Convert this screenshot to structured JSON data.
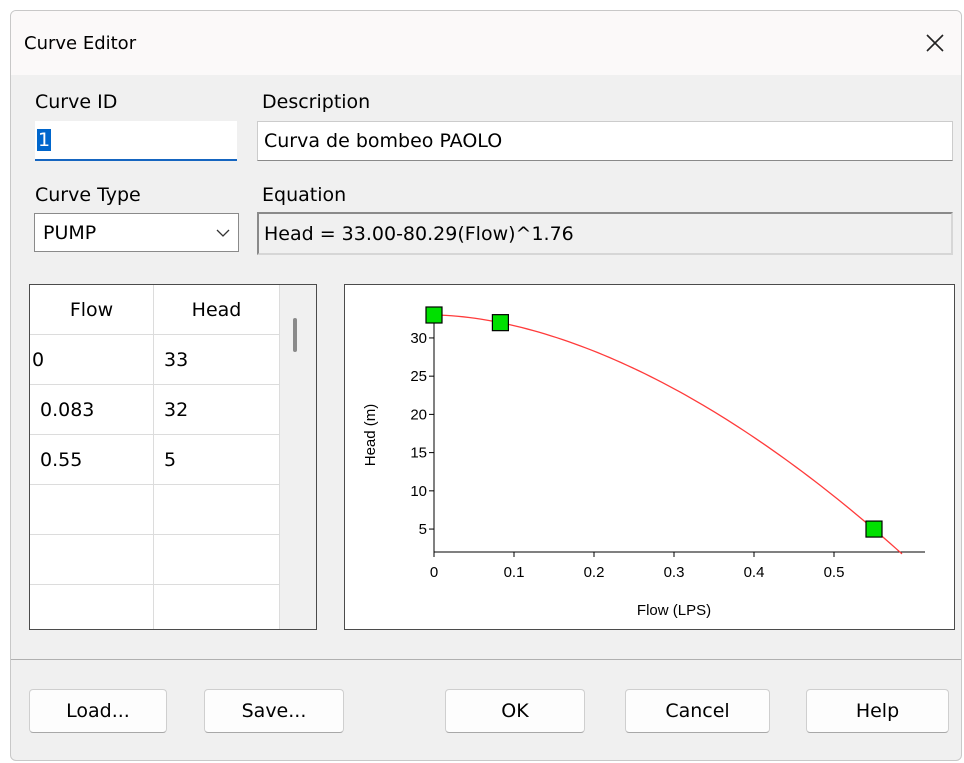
{
  "window": {
    "title": "Curve Editor"
  },
  "labels": {
    "curve_id": "Curve ID",
    "description": "Description",
    "curve_type": "Curve Type",
    "equation": "Equation"
  },
  "fields": {
    "curve_id_value": "1",
    "description_value": "Curva de bombeo PAOLO",
    "curve_type_value": "PUMP",
    "equation_value": "Head = 33.00-80.29(Flow)^1.76"
  },
  "grid": {
    "headers": [
      "Flow",
      "Head"
    ],
    "rows": [
      [
        "0",
        "33"
      ],
      [
        "0.083",
        "32"
      ],
      [
        "0.55",
        "5"
      ],
      [
        "",
        ""
      ],
      [
        "",
        ""
      ],
      [
        "",
        ""
      ]
    ]
  },
  "buttons": {
    "load": "Load...",
    "save": "Save...",
    "ok": "OK",
    "cancel": "Cancel",
    "help": "Help"
  },
  "chart_data": {
    "type": "line",
    "xlabel": "Flow (LPS)",
    "ylabel": "Head (m)",
    "xlim": [
      0,
      0.6
    ],
    "ylim": [
      2,
      33
    ],
    "x_ticks": [
      0,
      0.1,
      0.2,
      0.3,
      0.4,
      0.5
    ],
    "x_tick_labels": [
      "0",
      "0.1",
      "0.2",
      "0.3",
      "0.4",
      "0.5"
    ],
    "y_ticks": [
      5,
      10,
      15,
      20,
      25,
      30
    ],
    "y_tick_labels": [
      "5",
      "10",
      "15",
      "20",
      "25",
      "30"
    ],
    "curve": {
      "equation": {
        "a": 33.0,
        "b": 80.29,
        "c": 1.76
      },
      "x_end": 0.585,
      "color": "#ff3b3b"
    },
    "points": {
      "x": [
        0,
        0.083,
        0.55
      ],
      "y": [
        33,
        32,
        5
      ],
      "color": "#00e000"
    },
    "grid": false
  }
}
